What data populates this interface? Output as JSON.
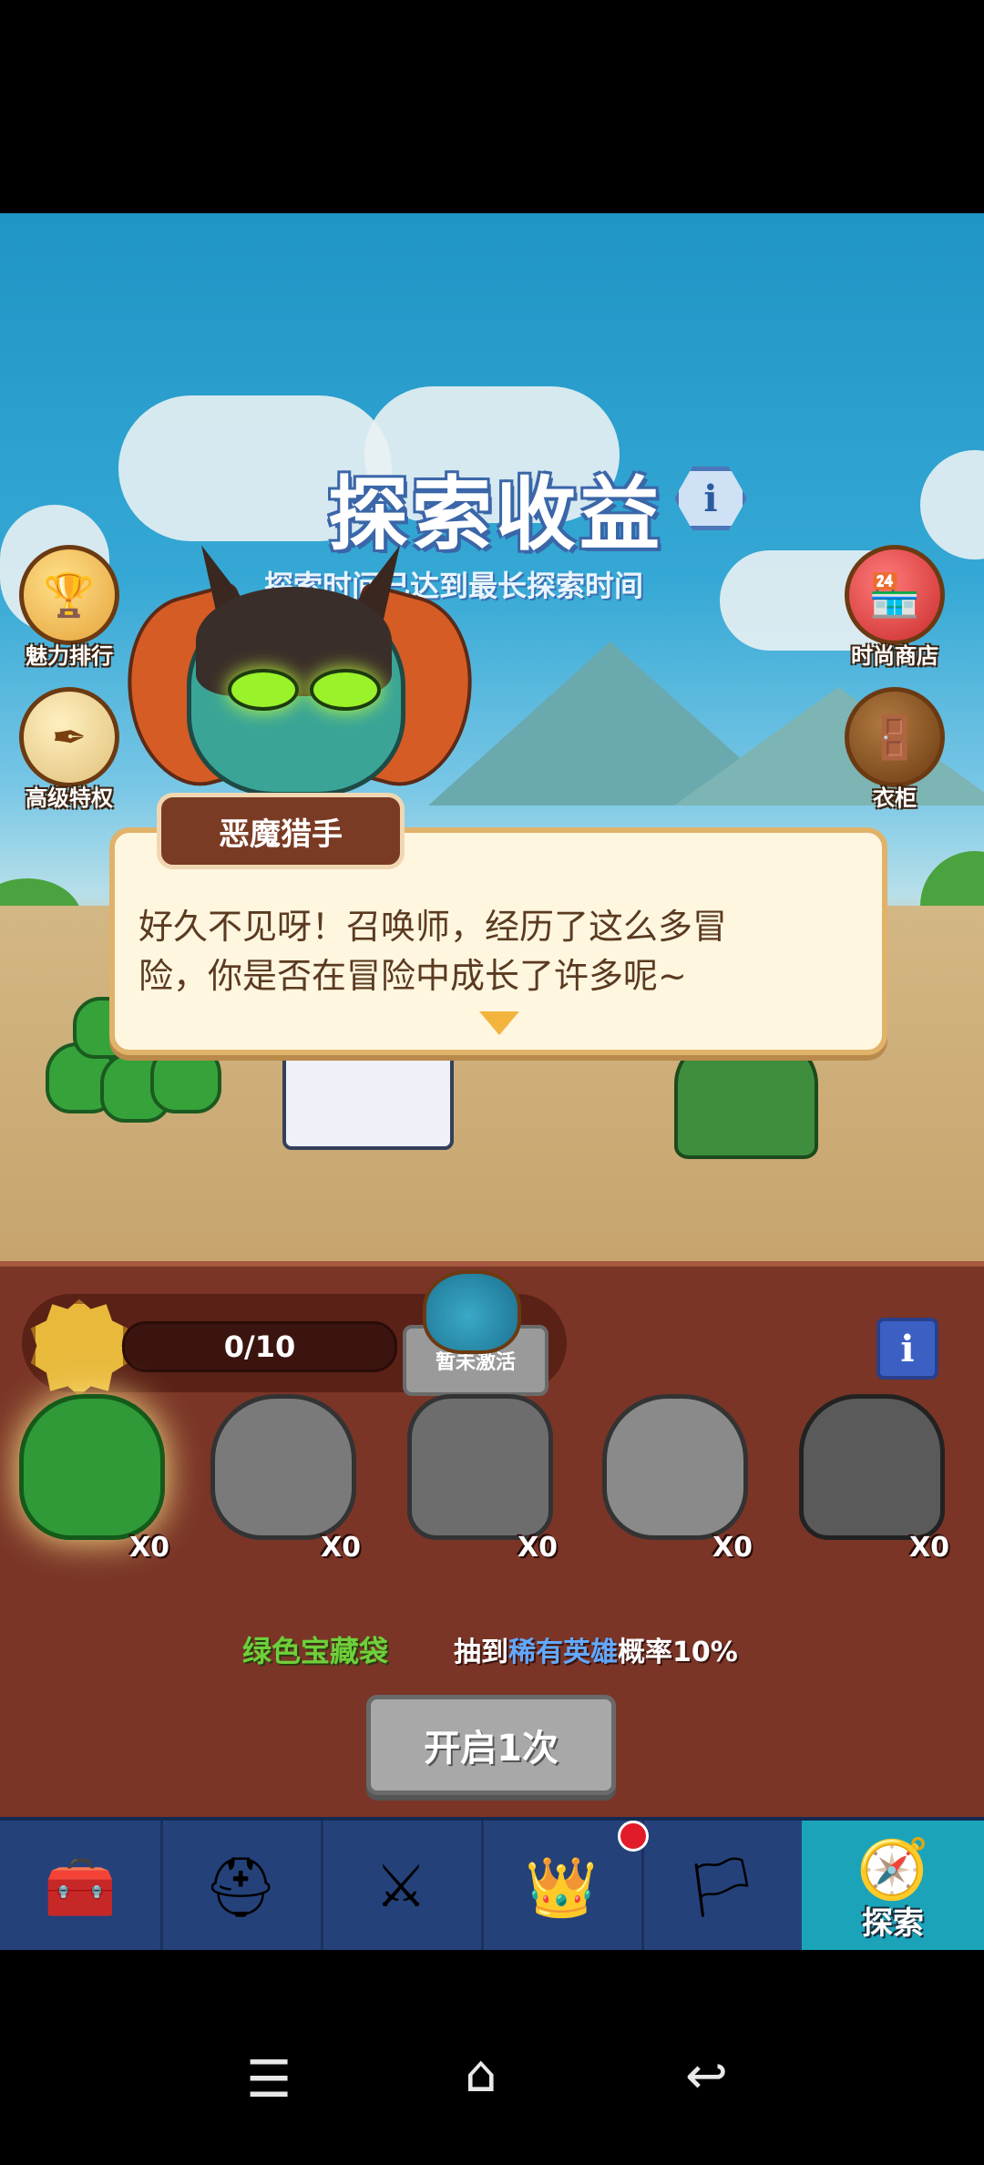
{
  "header": {
    "title": "探索收益",
    "subtitle": "探索时间已达到最长探索时间"
  },
  "side_left": [
    {
      "label": "魅力排行",
      "icon": "ranking-icon"
    },
    {
      "label": "高级特权",
      "icon": "privilege-icon"
    }
  ],
  "side_right": [
    {
      "label": "时尚商店",
      "icon": "shop-icon"
    },
    {
      "label": "衣柜",
      "icon": "wardrobe-icon"
    }
  ],
  "dialog": {
    "speaker": "恶魔猎手",
    "line1": "好久不见呀！召唤师，经历了这么多冒",
    "line2": "险，你是否在冒险中成长了许多呢~"
  },
  "panel": {
    "progress": "0/10",
    "inactive_label": "暂未激活",
    "bags": [
      {
        "count": "X0",
        "color": "#2f9a37"
      },
      {
        "count": "X0",
        "color": "#7a7a7a"
      },
      {
        "count": "X0",
        "color": "#6d6d6d"
      },
      {
        "count": "X0",
        "color": "#8a8a8a"
      },
      {
        "count": "X0",
        "color": "#5a5a5a"
      }
    ],
    "bag_name": "绿色宝藏袋",
    "rate_prefix": "抽到",
    "rate_highlight": "稀有英雄",
    "rate_suffix": "概率10%",
    "open_button": "开启1次"
  },
  "tabs": [
    {
      "icon": "treasure-chest-icon"
    },
    {
      "icon": "knight-helmet-icon"
    },
    {
      "icon": "crossed-swords-icon"
    },
    {
      "icon": "crown-shield-icon"
    },
    {
      "icon": "guild-banner-icon"
    },
    {
      "icon": "compass-icon",
      "label": "探索"
    }
  ],
  "colors": {
    "accent_green": "#6fd03a",
    "highlight_blue": "#62a9ff",
    "panel_bg": "#7a3527",
    "tab_active": "#1ba4b9"
  }
}
